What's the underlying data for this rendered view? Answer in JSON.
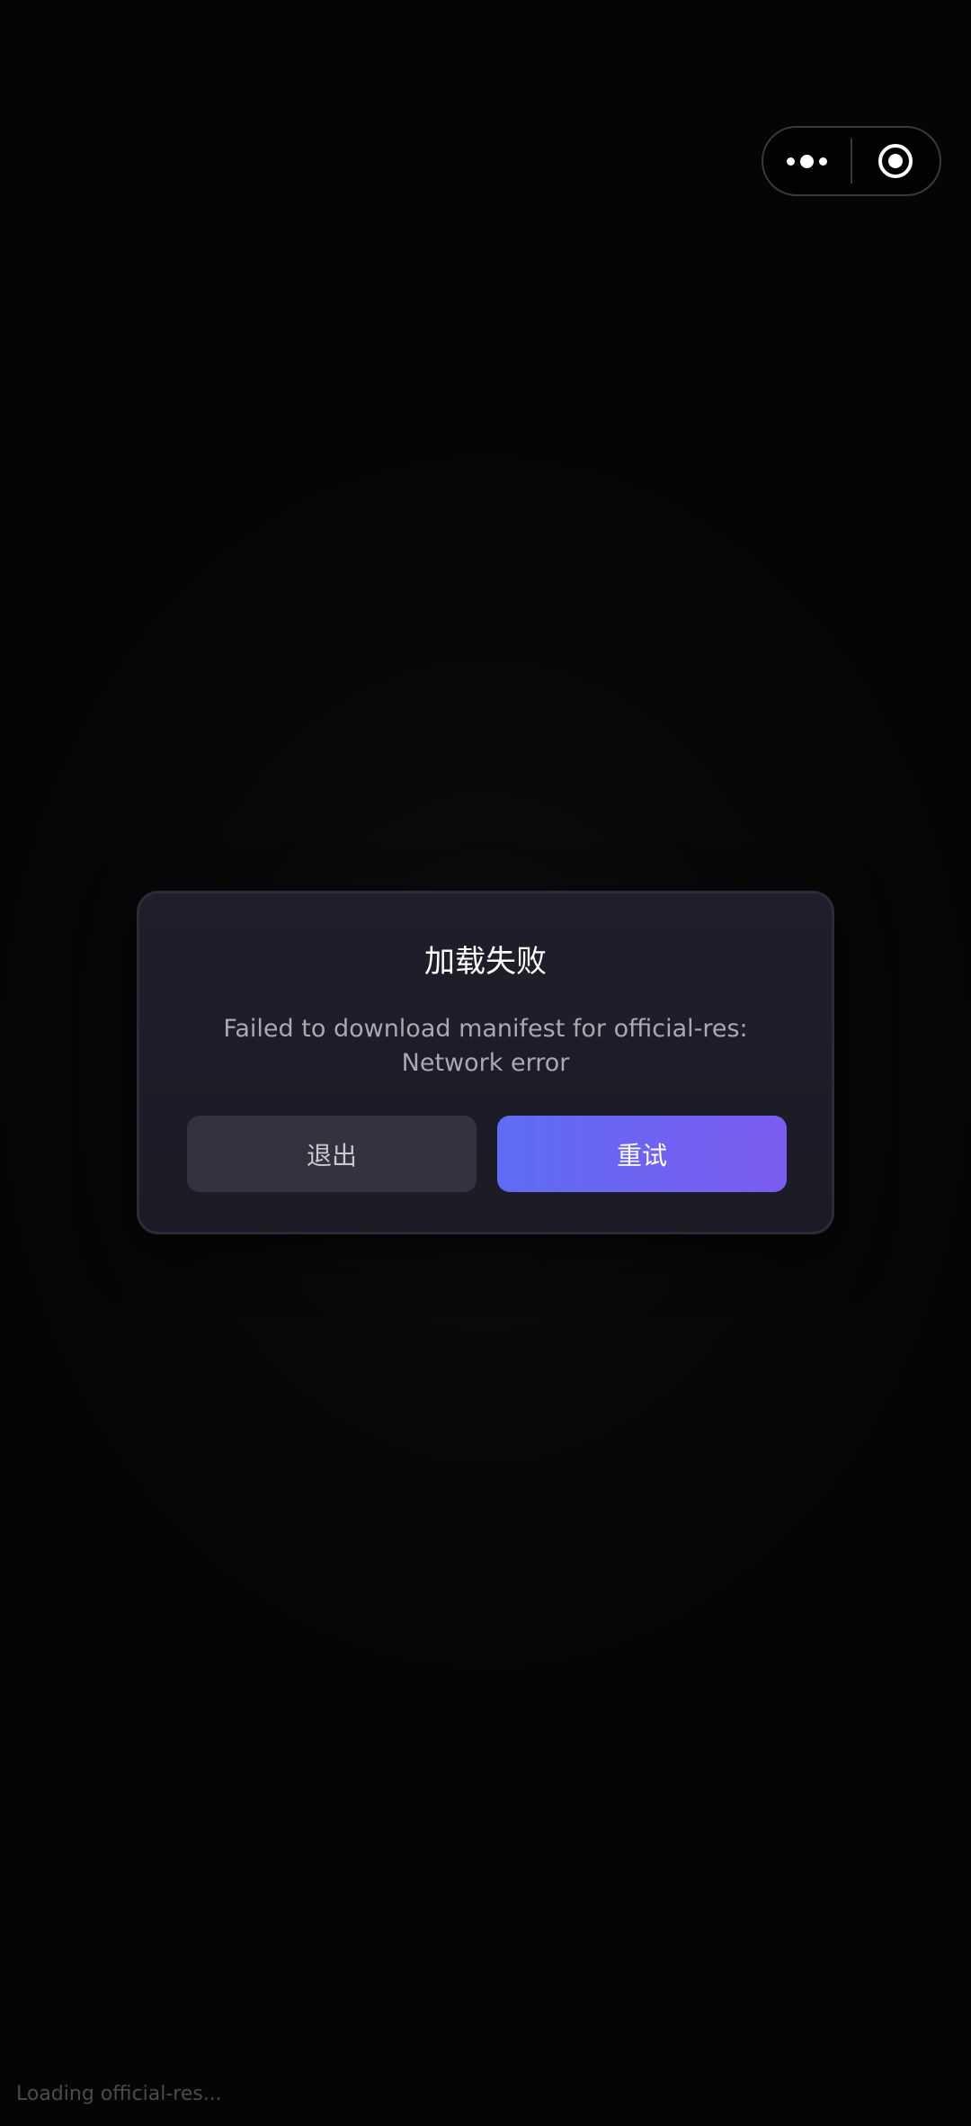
{
  "capsule": {
    "menu_icon": "more-dots-icon",
    "close_icon": "target-circle-icon"
  },
  "dialog": {
    "title": "加载失败",
    "message": "Failed to download manifest for official-res: Network error",
    "exit_label": "退出",
    "retry_label": "重试"
  },
  "status": {
    "loading_text": "Loading official-res..."
  },
  "colors": {
    "background": "#050505",
    "dialog_bg": "#1f1f2c",
    "exit_button": "#33333f",
    "retry_gradient_start": "#5f6cf5",
    "retry_gradient_end": "#7b5cf0"
  }
}
